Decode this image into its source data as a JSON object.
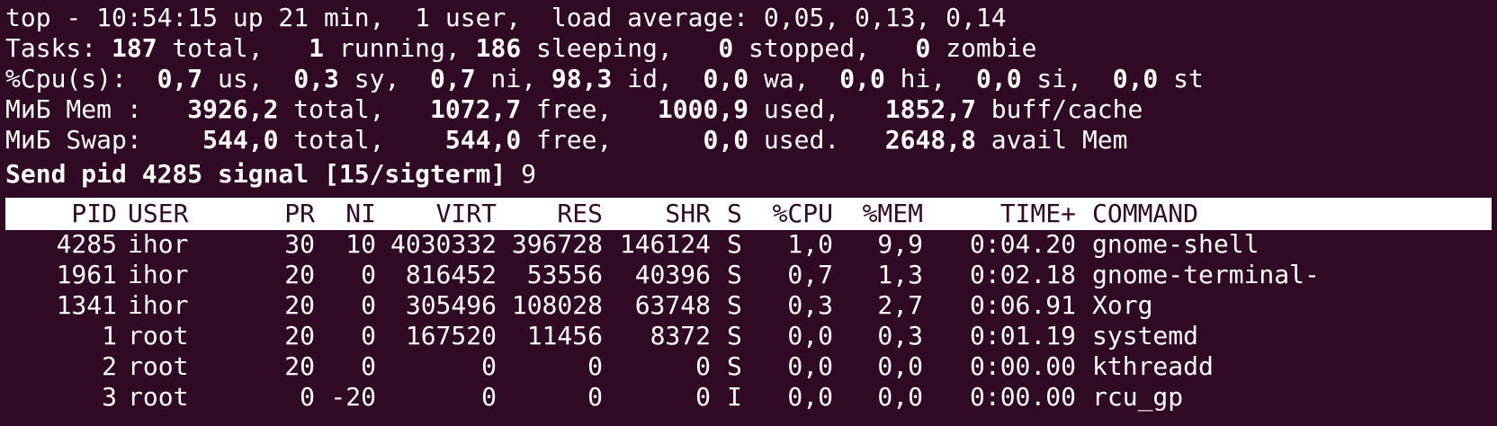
{
  "summary": {
    "line1": "top - 10:54:15 up 21 min,  1 user,  load average: 0,05, 0,13, 0,14",
    "tasks": {
      "label": "Tasks: ",
      "total": "187",
      "total_label": " total,   ",
      "running": "1",
      "running_label": " running, ",
      "sleeping": "186",
      "sleeping_label": " sleeping,   ",
      "stopped": "0",
      "stopped_label": " stopped,   ",
      "zombie": "0",
      "zombie_label": " zombie"
    },
    "cpu": {
      "label": "%Cpu(s):  ",
      "us": "0,7",
      "us_label": " us,  ",
      "sy": "0,3",
      "sy_label": " sy,  ",
      "ni": "0,7",
      "ni_label": " ni, ",
      "id": "98,3",
      "id_label": " id,  ",
      "wa": "0,0",
      "wa_label": " wa,  ",
      "hi": "0,0",
      "hi_label": " hi,  ",
      "si": "0,0",
      "si_label": " si,  ",
      "st": "0,0",
      "st_label": " st"
    },
    "mem": {
      "label": "МиБ Mem :   ",
      "total": "3926,2",
      "total_label": " total,   ",
      "free": "1072,7",
      "free_label": " free,   ",
      "used": "1000,9",
      "used_label": " used,   ",
      "buff": "1852,7",
      "buff_label": " buff/cache"
    },
    "swap": {
      "label": "МиБ Swap:    ",
      "total": "544,0",
      "total_label": " total,    ",
      "free": "544,0",
      "free_label": " free,      ",
      "used": "0,0",
      "used_label": " used.   ",
      "avail": "2648,8",
      "avail_label": " avail Mem"
    },
    "prompt": "Send pid 4285 signal [15/sigterm]",
    "prompt_input": " 9"
  },
  "table": {
    "headers": {
      "pid": "PID",
      "user": "USER",
      "pr": "PR",
      "ni": "NI",
      "virt": "VIRT",
      "res": "RES",
      "shr": "SHR",
      "s": "S",
      "cpu": "%CPU",
      "mem": "%MEM",
      "time": "TIME+",
      "command": "COMMAND"
    },
    "rows": [
      {
        "pid": "4285",
        "user": "ihor",
        "pr": "30",
        "ni": "10",
        "virt": "4030332",
        "res": "396728",
        "shr": "146124",
        "s": "S",
        "cpu": "1,0",
        "mem": "9,9",
        "time": "0:04.20",
        "command": "gnome-shell"
      },
      {
        "pid": "1961",
        "user": "ihor",
        "pr": "20",
        "ni": "0",
        "virt": "816452",
        "res": "53556",
        "shr": "40396",
        "s": "S",
        "cpu": "0,7",
        "mem": "1,3",
        "time": "0:02.18",
        "command": "gnome-terminal-"
      },
      {
        "pid": "1341",
        "user": "ihor",
        "pr": "20",
        "ni": "0",
        "virt": "305496",
        "res": "108028",
        "shr": "63748",
        "s": "S",
        "cpu": "0,3",
        "mem": "2,7",
        "time": "0:06.91",
        "command": "Xorg"
      },
      {
        "pid": "1",
        "user": "root",
        "pr": "20",
        "ni": "0",
        "virt": "167520",
        "res": "11456",
        "shr": "8372",
        "s": "S",
        "cpu": "0,0",
        "mem": "0,3",
        "time": "0:01.19",
        "command": "systemd"
      },
      {
        "pid": "2",
        "user": "root",
        "pr": "20",
        "ni": "0",
        "virt": "0",
        "res": "0",
        "shr": "0",
        "s": "S",
        "cpu": "0,0",
        "mem": "0,0",
        "time": "0:00.00",
        "command": "kthreadd"
      },
      {
        "pid": "3",
        "user": "root",
        "pr": "0",
        "ni": "-20",
        "virt": "0",
        "res": "0",
        "shr": "0",
        "s": "I",
        "cpu": "0,0",
        "mem": "0,0",
        "time": "0:00.00",
        "command": "rcu_gp"
      }
    ]
  },
  "colors": {
    "background": "#300a24",
    "foreground": "#ffffff",
    "header_background": "#ffffff",
    "header_foreground": "#300a24"
  }
}
